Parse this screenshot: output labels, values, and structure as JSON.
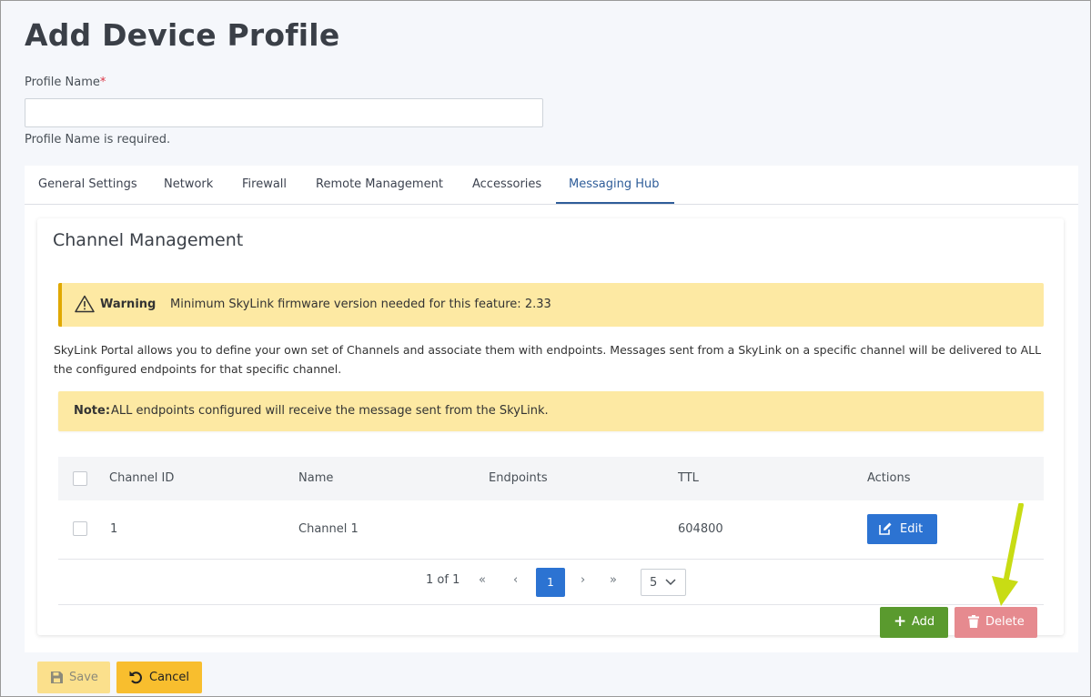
{
  "page": {
    "title": "Add Device Profile"
  },
  "form": {
    "profile_name_label": "Profile Name",
    "required_marker": "*",
    "profile_name_value": "",
    "profile_name_error": "Profile Name is required."
  },
  "tabs": [
    {
      "label": "General Settings"
    },
    {
      "label": "Network"
    },
    {
      "label": "Firewall"
    },
    {
      "label": "Remote Management"
    },
    {
      "label": "Accessories"
    },
    {
      "label": "Messaging Hub",
      "active": true
    }
  ],
  "channel_management": {
    "title": "Channel Management",
    "warning": {
      "label": "Warning",
      "text": "Minimum SkyLink firmware version needed for this feature: 2.33"
    },
    "description": "SkyLink Portal allows you to define your own set of Channels and associate them with endpoints. Messages sent from a SkyLink on a specific channel will be delivered to ALL the configured endpoints for that specific channel.",
    "note": {
      "label": "Note:",
      "text": "ALL endpoints configured will receive the message sent from the SkyLink."
    },
    "table": {
      "columns": [
        "Channel ID",
        "Name",
        "Endpoints",
        "TTL",
        "Actions"
      ],
      "rows": [
        {
          "channel_id": "1",
          "name": "Channel 1",
          "endpoints": "",
          "ttl": "604800",
          "action_label": "Edit"
        }
      ]
    },
    "pagination": {
      "info": "1 of 1",
      "first": "«",
      "prev": "‹",
      "current_page": "1",
      "next": "›",
      "last": "»",
      "page_size": "5"
    },
    "buttons": {
      "add_label": "Add",
      "delete_label": "Delete"
    }
  },
  "footer": {
    "save_label": "Save",
    "cancel_label": "Cancel"
  },
  "colors": {
    "primary_blue": "#2c73d2",
    "tab_active": "#2f5d99",
    "warning_bg": "#fde9a3",
    "warning_border": "#e0a800",
    "add_green": "#5a9a2e",
    "delete_red": "#e68a8f",
    "cancel_yellow": "#f8be2e",
    "save_yellow_disabled": "#fbe08c",
    "annotation_arrow": "#c8dc14"
  },
  "icons": {
    "warning": "warning-triangle-icon",
    "edit": "edit-icon",
    "add": "plus-icon",
    "delete": "trash-icon",
    "save": "floppy-disk-icon",
    "cancel": "undo-icon",
    "page_size": "chevron-down-icon",
    "annotation": "arrow-down-icon"
  }
}
